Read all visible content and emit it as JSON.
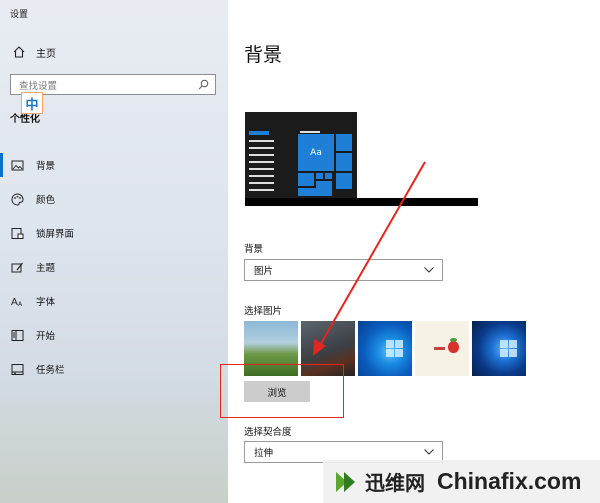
{
  "window": {
    "title": "设置"
  },
  "sidebar": {
    "home_label": "主页",
    "search_placeholder": "查找设置",
    "ime_indicator": "中",
    "section_title": "个性化",
    "items": [
      {
        "label": "背景",
        "icon": "image-icon",
        "active": true
      },
      {
        "label": "颜色",
        "icon": "palette-icon",
        "active": false
      },
      {
        "label": "锁屏界面",
        "icon": "lock-screen-icon",
        "active": false
      },
      {
        "label": "主题",
        "icon": "theme-icon",
        "active": false
      },
      {
        "label": "字体",
        "icon": "font-icon",
        "active": false
      },
      {
        "label": "开始",
        "icon": "start-icon",
        "active": false
      },
      {
        "label": "任务栏",
        "icon": "taskbar-icon",
        "active": false
      }
    ]
  },
  "main": {
    "title": "背景",
    "preview_tile_text": "Aa",
    "background_label": "背景",
    "background_value": "图片",
    "choose_picture_label": "选择图片",
    "thumbnails": [
      "landscape",
      "rocks",
      "windows-blue",
      "strawberry",
      "windows-dark"
    ],
    "browse_label": "浏览",
    "fit_label": "选择契合度",
    "fit_value": "拉伸"
  },
  "watermark": {
    "cn": "迅维网",
    "en": "Chinafix.com"
  },
  "colors": {
    "accent": "#0b6fce",
    "annotation": "#e3261f"
  }
}
